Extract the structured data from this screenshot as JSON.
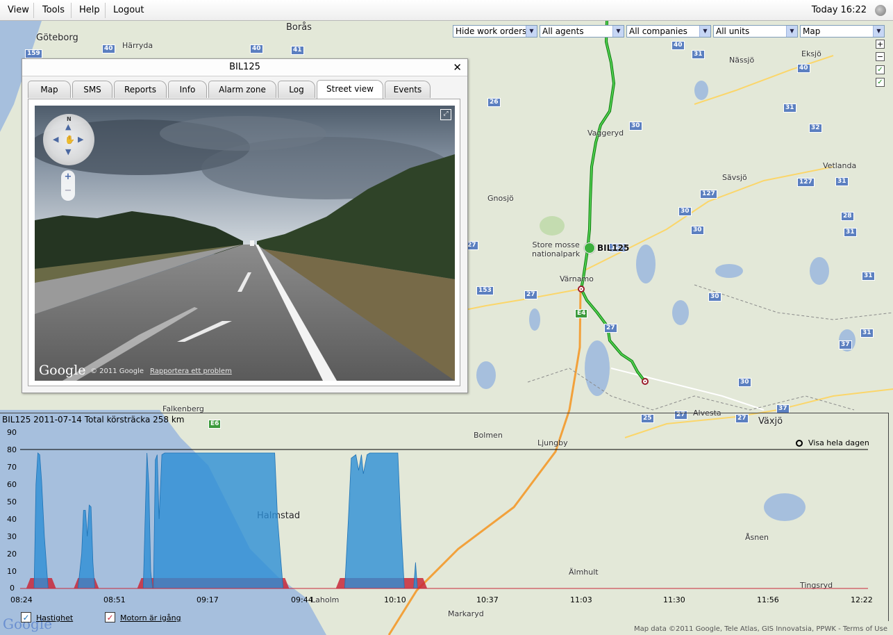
{
  "menu": {
    "view": "View",
    "tools": "Tools",
    "help": "Help",
    "logout": "Logout"
  },
  "clock": "Today 16:22",
  "filters": {
    "workorders": "Hide work orders",
    "agents": "All agents",
    "companies": "All companies",
    "units": "All units",
    "maptype": "Map"
  },
  "map": {
    "vehicle": "BIL125",
    "park": "Store mosse\nnationalpark",
    "places": [
      "Göteborg",
      "Borås",
      "Härryda",
      "Nässjö",
      "Eksjö",
      "Vaggeryd",
      "Sävsjö",
      "Vetlanda",
      "Gnosjö",
      "Värnamo",
      "Alvesta",
      "Växjö",
      "Falkenberg",
      "Bolmen",
      "Ljungby",
      "Halmstad",
      "Laholm",
      "Älmhult",
      "Markaryd",
      "Tingsryd",
      "Åsnen"
    ],
    "credit": "Map data ©2011 Google, Tele Atlas, GIS Innovatsia, PPWK - Terms of Use"
  },
  "dialog": {
    "title": "BIL125",
    "tabs": [
      "Map",
      "SMS",
      "Reports",
      "Info",
      "Alarm zone",
      "Log",
      "Street view",
      "Events"
    ],
    "active_tab": "Street view",
    "copyright": "© 2011 Google",
    "report_link": "Rapportera ett problem",
    "logo": "Google",
    "north": "N"
  },
  "chart_data": {
    "type": "area",
    "title": "BIL125 2011-07-14 Total körsträcka 258 km",
    "xlabel": "",
    "ylabel": "",
    "ylim": [
      0,
      90
    ],
    "yticks": [
      0,
      10,
      20,
      30,
      40,
      50,
      60,
      70,
      80,
      90
    ],
    "xticks": [
      "08:24",
      "08:51",
      "09:17",
      "09:44",
      "10:10",
      "10:37",
      "11:03",
      "11:30",
      "11:56",
      "12:22"
    ],
    "reference_line": 80,
    "series": [
      {
        "name": "Hastighet",
        "color": "#2d8fd6",
        "points": [
          [
            0,
            0
          ],
          [
            0.08,
            0
          ],
          [
            0.12,
            0
          ],
          [
            0.15,
            0
          ],
          [
            0.17,
            60
          ],
          [
            0.19,
            78
          ],
          [
            0.21,
            77
          ],
          [
            0.23,
            62
          ],
          [
            0.26,
            30
          ],
          [
            0.3,
            0
          ],
          [
            0.62,
            0
          ],
          [
            0.66,
            20
          ],
          [
            0.68,
            45
          ],
          [
            0.7,
            45
          ],
          [
            0.72,
            30
          ],
          [
            0.74,
            48
          ],
          [
            0.76,
            47
          ],
          [
            0.78,
            15
          ],
          [
            0.8,
            0
          ],
          [
            1.32,
            0
          ],
          [
            1.34,
            40
          ],
          [
            1.36,
            78
          ],
          [
            1.38,
            60
          ],
          [
            1.4,
            10
          ],
          [
            1.42,
            0
          ],
          [
            1.43,
            0
          ],
          [
            1.45,
            74
          ],
          [
            1.47,
            77
          ],
          [
            1.49,
            40
          ],
          [
            1.52,
            77
          ],
          [
            1.55,
            78
          ],
          [
            2.2,
            78
          ],
          [
            2.6,
            78
          ],
          [
            2.7,
            78
          ],
          [
            2.73,
            78
          ],
          [
            2.76,
            40
          ],
          [
            2.82,
            0
          ],
          [
            3.48,
            0
          ],
          [
            3.52,
            40
          ],
          [
            3.55,
            75
          ],
          [
            3.6,
            77
          ],
          [
            3.63,
            68
          ],
          [
            3.66,
            77
          ],
          [
            3.68,
            66
          ],
          [
            3.72,
            77
          ],
          [
            3.75,
            78
          ],
          [
            4.0,
            78
          ],
          [
            4.05,
            78
          ],
          [
            4.08,
            40
          ],
          [
            4.12,
            0
          ],
          [
            4.22,
            0
          ],
          [
            4.24,
            15
          ],
          [
            4.26,
            0
          ],
          [
            4.4,
            0
          ]
        ]
      },
      {
        "name": "Motorn är igång",
        "color": "#c8283a",
        "intervals": [
          [
            0.11,
            0.34
          ],
          [
            0.62,
            0.8
          ],
          [
            1.3,
            2.84
          ],
          [
            3.43,
            4.32
          ]
        ],
        "value": 5
      }
    ],
    "zoom_label": "Visa hela dagen",
    "legend": [
      "Hastighet",
      "Motorn är igång"
    ]
  }
}
